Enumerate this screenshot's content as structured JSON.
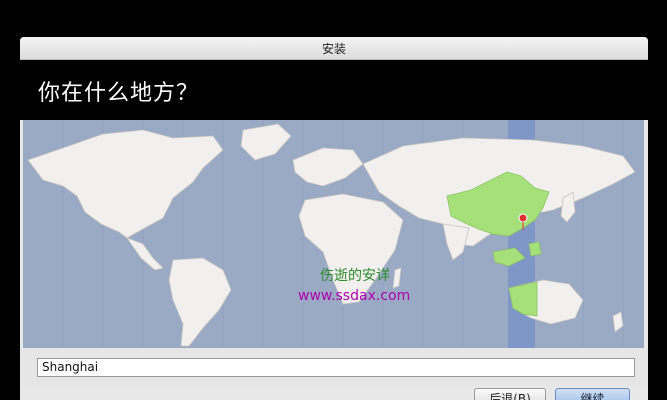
{
  "window": {
    "title": "安装"
  },
  "header": {
    "question": "你在什么地方？"
  },
  "map": {
    "selected_city": "Shanghai",
    "highlight_color": "#a6e07a",
    "land_color": "#f2f0ee",
    "ocean_color": "#9aa9c4",
    "timezone_band_color": "#7f97c7",
    "marker_color": "#e03030"
  },
  "watermark": {
    "line1": "伤逝的安详",
    "line2": "www.ssdax.com"
  },
  "location_input": {
    "value": "Shanghai"
  },
  "buttons": {
    "back": "后退(B)",
    "next": "继续"
  }
}
